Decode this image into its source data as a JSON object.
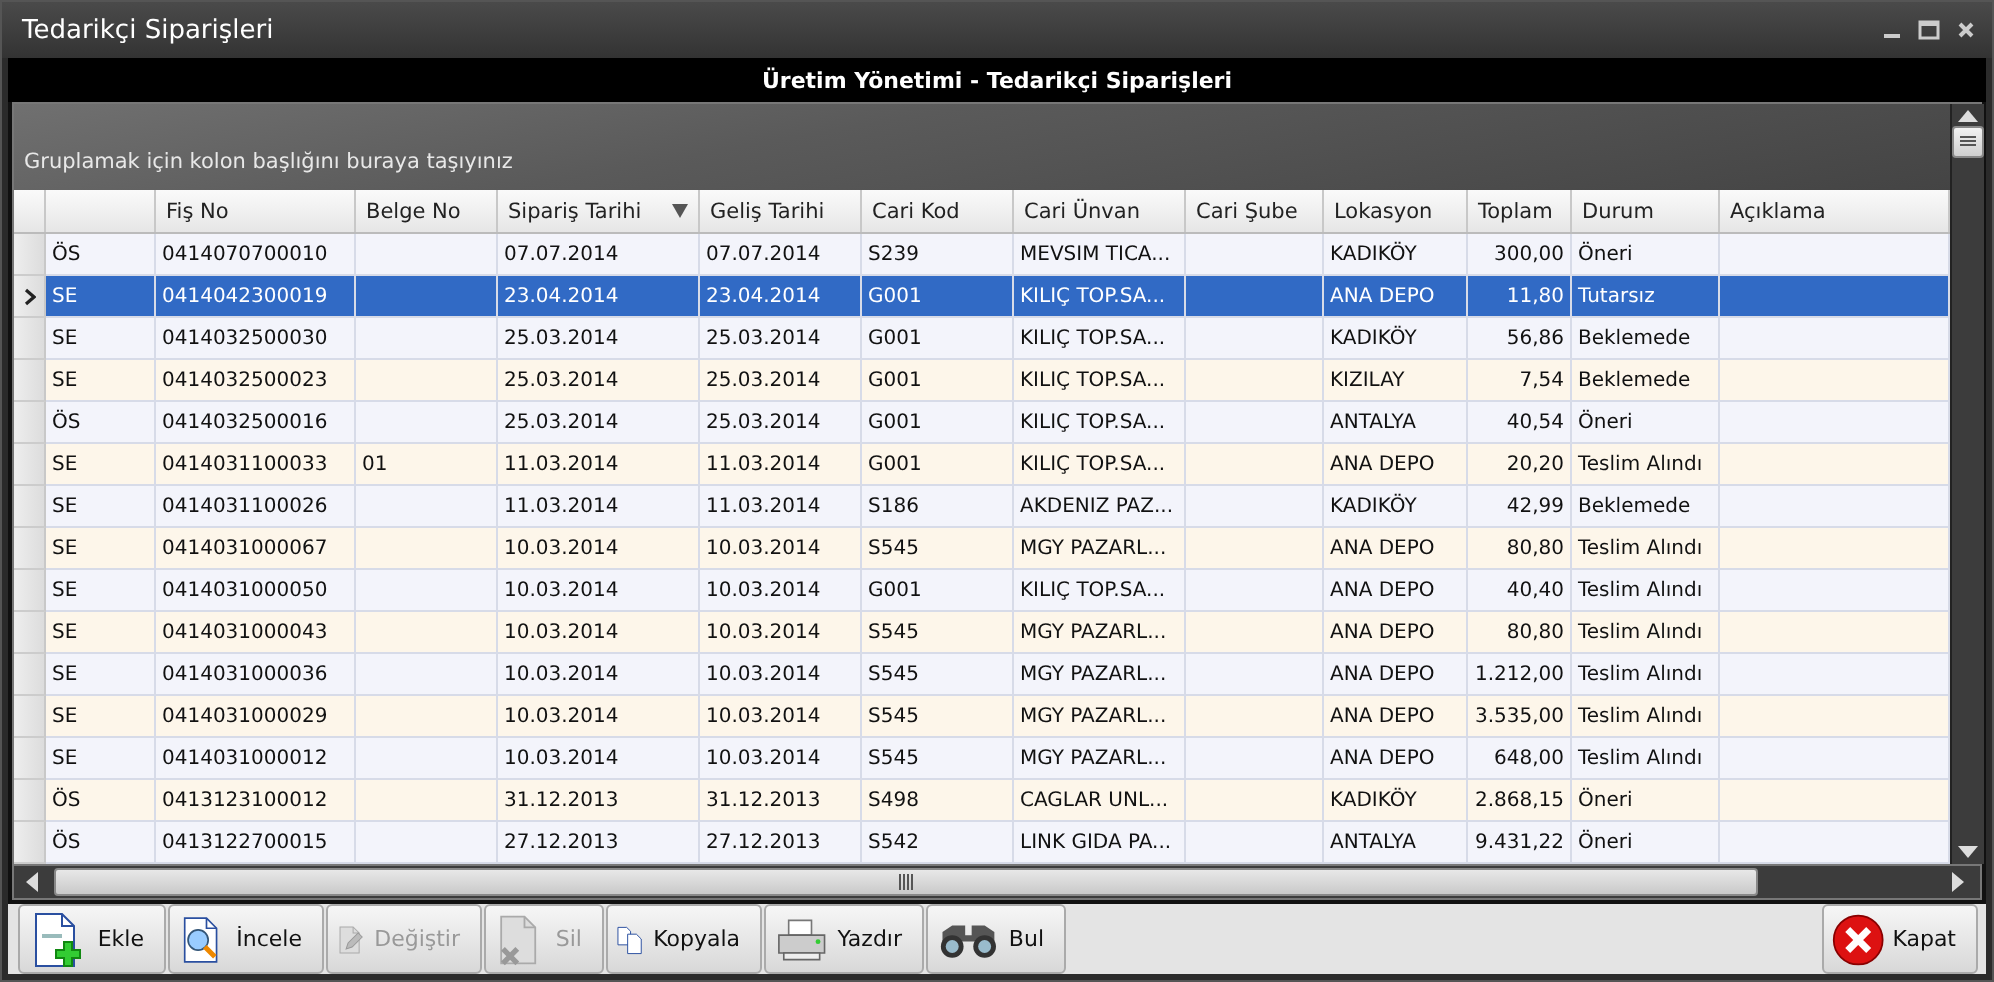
{
  "window": {
    "title": "Tedarikçi Siparişleri"
  },
  "banner": "Üretim Yönetimi - Tedarikçi Siparişleri",
  "group_panel": {
    "hint": "Gruplamak için kolon başlığını buraya taşıyınız"
  },
  "table": {
    "columns": [
      {
        "label": "Fiş No",
        "sorted": false
      },
      {
        "label": "Belge No",
        "sorted": false
      },
      {
        "label": "Sipariş Tarihi",
        "sorted": true
      },
      {
        "label": "Geliş Tarihi",
        "sorted": false
      },
      {
        "label": "Cari Kod",
        "sorted": false
      },
      {
        "label": "Cari Ünvan",
        "sorted": false
      },
      {
        "label": "Cari Şube",
        "sorted": false
      },
      {
        "label": "Lokasyon",
        "sorted": false
      },
      {
        "label": "Toplam",
        "sorted": false
      },
      {
        "label": "Durum",
        "sorted": false
      },
      {
        "label": "Açıklama",
        "sorted": false
      }
    ],
    "rows": [
      {
        "type": "ÖS",
        "fis_no": "0414070700010",
        "siparis_tarihi": "07.07.2014",
        "gelis_tarihi": "07.07.2014",
        "cari_kod": "S239",
        "cari_unvan": "MEVSIM TICA...",
        "lokasyon": "KADIKÖY",
        "toplam": "300,00",
        "durum": "Öneri",
        "selected": false
      },
      {
        "type": "SE",
        "fis_no": "0414042300019",
        "siparis_tarihi": "23.04.2014",
        "gelis_tarihi": "23.04.2014",
        "cari_kod": "G001",
        "cari_unvan": "KILIÇ TOP.SA...",
        "lokasyon": "ANA DEPO",
        "toplam": "11,80",
        "durum": "Tutarsız",
        "selected": true
      },
      {
        "type": "SE",
        "fis_no": "0414032500030",
        "siparis_tarihi": "25.03.2014",
        "gelis_tarihi": "25.03.2014",
        "cari_kod": "G001",
        "cari_unvan": "KILIÇ TOP.SA...",
        "lokasyon": "KADIKÖY",
        "toplam": "56,86",
        "durum": "Beklemede",
        "selected": false
      },
      {
        "type": "SE",
        "fis_no": "0414032500023",
        "siparis_tarihi": "25.03.2014",
        "gelis_tarihi": "25.03.2014",
        "cari_kod": "G001",
        "cari_unvan": "KILIÇ TOP.SA...",
        "lokasyon": "KIZILAY",
        "toplam": "7,54",
        "durum": "Beklemede",
        "selected": false
      },
      {
        "type": "ÖS",
        "fis_no": "0414032500016",
        "siparis_tarihi": "25.03.2014",
        "gelis_tarihi": "25.03.2014",
        "cari_kod": "G001",
        "cari_unvan": "KILIÇ TOP.SA...",
        "lokasyon": "ANTALYA",
        "toplam": "40,54",
        "durum": "Öneri",
        "selected": false
      },
      {
        "type": "SE",
        "fis_no": "0414031100033",
        "belge_no": "01",
        "siparis_tarihi": "11.03.2014",
        "gelis_tarihi": "11.03.2014",
        "cari_kod": "G001",
        "cari_unvan": "KILIÇ TOP.SA...",
        "lokasyon": "ANA DEPO",
        "toplam": "20,20",
        "durum": "Teslim Alındı",
        "selected": false
      },
      {
        "type": "SE",
        "fis_no": "0414031100026",
        "siparis_tarihi": "11.03.2014",
        "gelis_tarihi": "11.03.2014",
        "cari_kod": "S186",
        "cari_unvan": "AKDENIZ PAZ...",
        "lokasyon": "KADIKÖY",
        "toplam": "42,99",
        "durum": "Beklemede",
        "selected": false
      },
      {
        "type": "SE",
        "fis_no": "0414031000067",
        "siparis_tarihi": "10.03.2014",
        "gelis_tarihi": "10.03.2014",
        "cari_kod": "S545",
        "cari_unvan": "MGY PAZARL...",
        "lokasyon": "ANA DEPO",
        "toplam": "80,80",
        "durum": "Teslim Alındı",
        "selected": false
      },
      {
        "type": "SE",
        "fis_no": "0414031000050",
        "siparis_tarihi": "10.03.2014",
        "gelis_tarihi": "10.03.2014",
        "cari_kod": "G001",
        "cari_unvan": "KILIÇ TOP.SA...",
        "lokasyon": "ANA DEPO",
        "toplam": "40,40",
        "durum": "Teslim Alındı",
        "selected": false
      },
      {
        "type": "SE",
        "fis_no": "0414031000043",
        "siparis_tarihi": "10.03.2014",
        "gelis_tarihi": "10.03.2014",
        "cari_kod": "S545",
        "cari_unvan": "MGY PAZARL...",
        "lokasyon": "ANA DEPO",
        "toplam": "80,80",
        "durum": "Teslim Alındı",
        "selected": false
      },
      {
        "type": "SE",
        "fis_no": "0414031000036",
        "siparis_tarihi": "10.03.2014",
        "gelis_tarihi": "10.03.2014",
        "cari_kod": "S545",
        "cari_unvan": "MGY PAZARL...",
        "lokasyon": "ANA DEPO",
        "toplam": "1.212,00",
        "durum": "Teslim Alındı",
        "selected": false
      },
      {
        "type": "SE",
        "fis_no": "0414031000029",
        "siparis_tarihi": "10.03.2014",
        "gelis_tarihi": "10.03.2014",
        "cari_kod": "S545",
        "cari_unvan": "MGY PAZARL...",
        "lokasyon": "ANA DEPO",
        "toplam": "3.535,00",
        "durum": "Teslim Alındı",
        "selected": false
      },
      {
        "type": "SE",
        "fis_no": "0414031000012",
        "siparis_tarihi": "10.03.2014",
        "gelis_tarihi": "10.03.2014",
        "cari_kod": "S545",
        "cari_unvan": "MGY PAZARL...",
        "lokasyon": "ANA DEPO",
        "toplam": "648,00",
        "durum": "Teslim Alındı",
        "selected": false
      },
      {
        "type": "ÖS",
        "fis_no": "0413123100012",
        "siparis_tarihi": "31.12.2013",
        "gelis_tarihi": "31.12.2013",
        "cari_kod": "S498",
        "cari_unvan": "CAGLAR UNL...",
        "lokasyon": "KADIKÖY",
        "toplam": "2.868,15",
        "durum": "Öneri",
        "selected": false
      },
      {
        "type": "ÖS",
        "fis_no": "0413122700015",
        "siparis_tarihi": "27.12.2013",
        "gelis_tarihi": "27.12.2013",
        "cari_kod": "S542",
        "cari_unvan": "LINK GIDA PA...",
        "lokasyon": "ANTALYA",
        "toplam": "9.431,22",
        "durum": "Öneri",
        "selected": false
      }
    ]
  },
  "toolbar": [
    {
      "kind": "add",
      "label": "Ekle",
      "disabled": false
    },
    {
      "kind": "view",
      "label": "İncele",
      "disabled": false
    },
    {
      "kind": "edit",
      "label": "Değiştir",
      "disabled": true
    },
    {
      "kind": "delete",
      "label": "Sil",
      "disabled": true
    },
    {
      "kind": "copy",
      "label": "Kopyala",
      "disabled": false
    },
    {
      "kind": "print",
      "label": "Yazdır",
      "disabled": false
    },
    {
      "kind": "find",
      "label": "Bul",
      "disabled": false
    }
  ],
  "close_button": {
    "label": "Kapat"
  }
}
